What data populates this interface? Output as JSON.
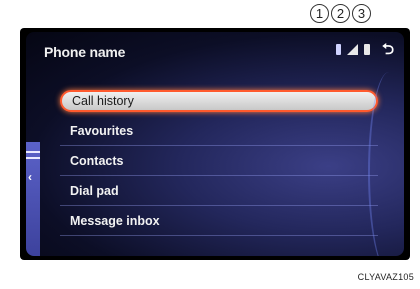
{
  "callouts": [
    "1",
    "2",
    "3"
  ],
  "header": {
    "title": "Phone name"
  },
  "status_icons": {
    "bluetooth": "bluetooth-icon",
    "signal": "signal-strength-icon",
    "battery": "battery-icon",
    "back": "back-icon"
  },
  "menu": {
    "items": [
      {
        "label": "Call history",
        "selected": true
      },
      {
        "label": "Favourites",
        "selected": false
      },
      {
        "label": "Contacts",
        "selected": false
      },
      {
        "label": "Dial pad",
        "selected": false
      },
      {
        "label": "Message inbox",
        "selected": false
      }
    ]
  },
  "colors": {
    "accent": "#ff5a2e",
    "background": "#1c1f4d",
    "tab": "#4a50b8"
  },
  "caption": "CLYAVAZ105"
}
